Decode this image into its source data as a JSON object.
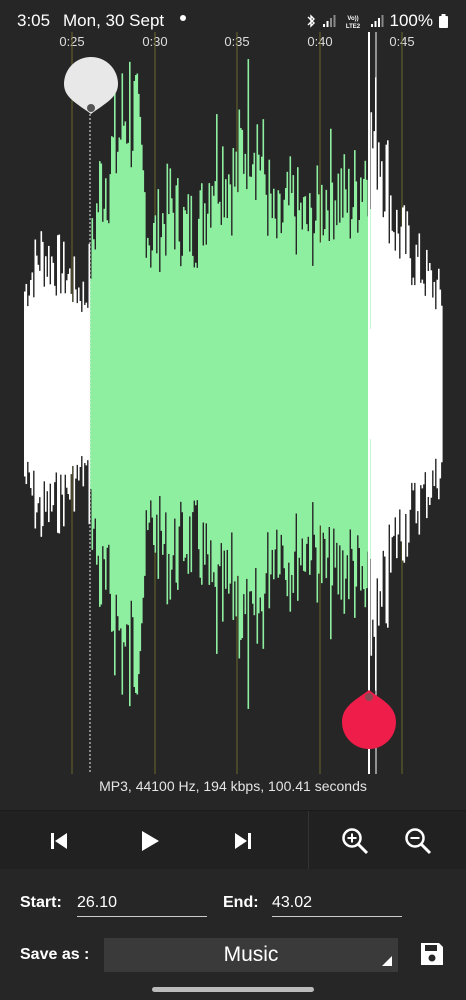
{
  "status": {
    "time": "3:05",
    "date": "Mon, 30 Sept",
    "battery": "100%",
    "network": "Vo)) LTE2"
  },
  "waveform": {
    "time_labels": [
      "0:25",
      "0:30",
      "0:35",
      "0:40",
      "0:45"
    ],
    "selection_color": "#8fefa0",
    "wave_color": "#ffffff",
    "start_marker_color": "#e8e8e8",
    "end_marker_color": "#ee1d4a"
  },
  "file_info": "MP3, 44100 Hz, 194 kbps, 100.41 seconds",
  "controls": {
    "prev_icon": "skip-previous-icon",
    "play_icon": "play-icon",
    "next_icon": "skip-next-icon",
    "zoom_in_icon": "zoom-in-icon",
    "zoom_out_icon": "zoom-out-icon"
  },
  "form": {
    "start_label": "Start:",
    "start_value": "26.10",
    "end_label": "End:",
    "end_value": "43.02",
    "save_as_label": "Save as :",
    "save_as_value": "Music",
    "save_icon": "save-icon"
  }
}
